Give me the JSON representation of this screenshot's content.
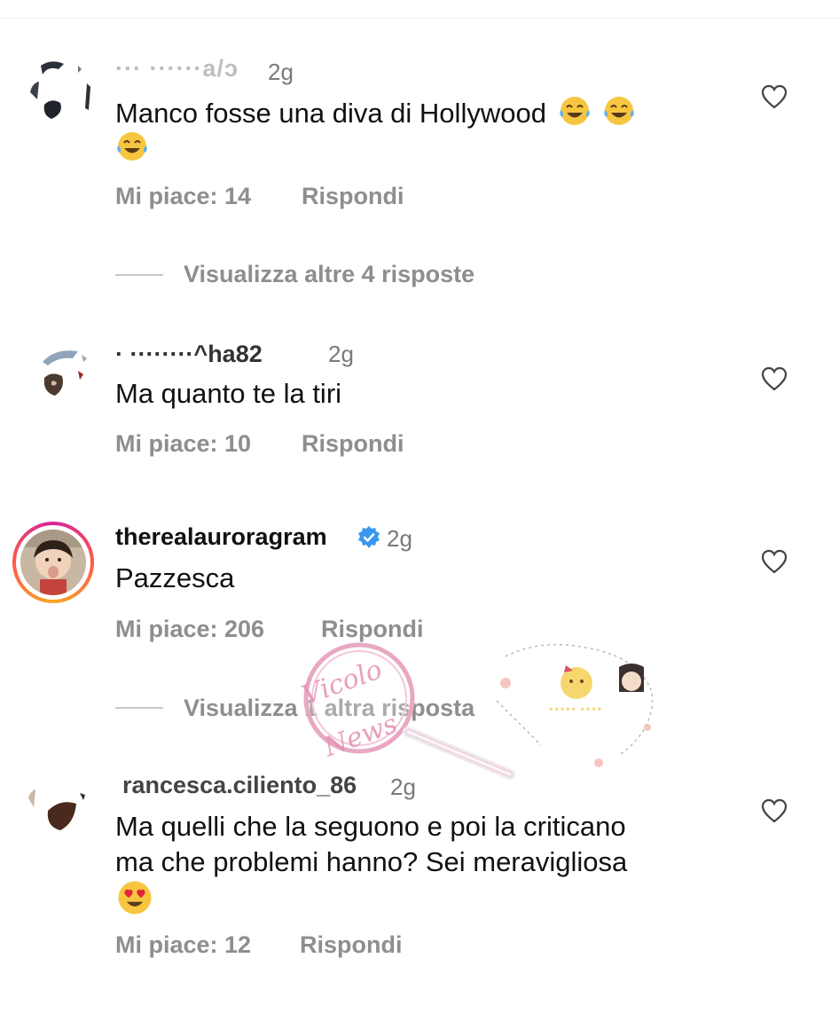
{
  "comments": [
    {
      "username": "··· ······a/ɔ",
      "time": "2g",
      "text": "Manco fosse una diva di Hollywood",
      "emojis": [
        "laughing-tears",
        "laughing-tears",
        "laughing-tears"
      ],
      "likes": "Mi piace: 14",
      "reply": "Rispondi",
      "view_replies": "Visualizza altre 4 risposte"
    },
    {
      "username": "· ········^ha82",
      "time": "2g",
      "text": "Ma quanto te la tiri",
      "emojis": [],
      "likes": "Mi piace: 10",
      "reply": "Rispondi"
    },
    {
      "username": "therealauroragram",
      "verified": true,
      "time": "2g",
      "text": "Pazzesca",
      "emojis": [],
      "likes": "Mi piace: 206",
      "reply": "Rispondi",
      "view_replies": "Visualizza 1 altra risposta"
    },
    {
      "username": "rancesca.ciliento_86",
      "time": "2g",
      "text_line1": "Ma quelli che la seguono e poi la criticano",
      "text_line2": "ma che problemi hanno? Sei meravigliosa",
      "emojis": [
        "heart-eyes"
      ],
      "likes": "Mi piace: 12",
      "reply": "Rispondi"
    }
  ],
  "watermark": {
    "text_1": "Vicolo",
    "text_2": "News"
  },
  "colors": {
    "muted": "#8e8e8e",
    "verified": "#3897f0",
    "story_ring_start": "#f9a825",
    "story_ring_end": "#d6249f"
  }
}
